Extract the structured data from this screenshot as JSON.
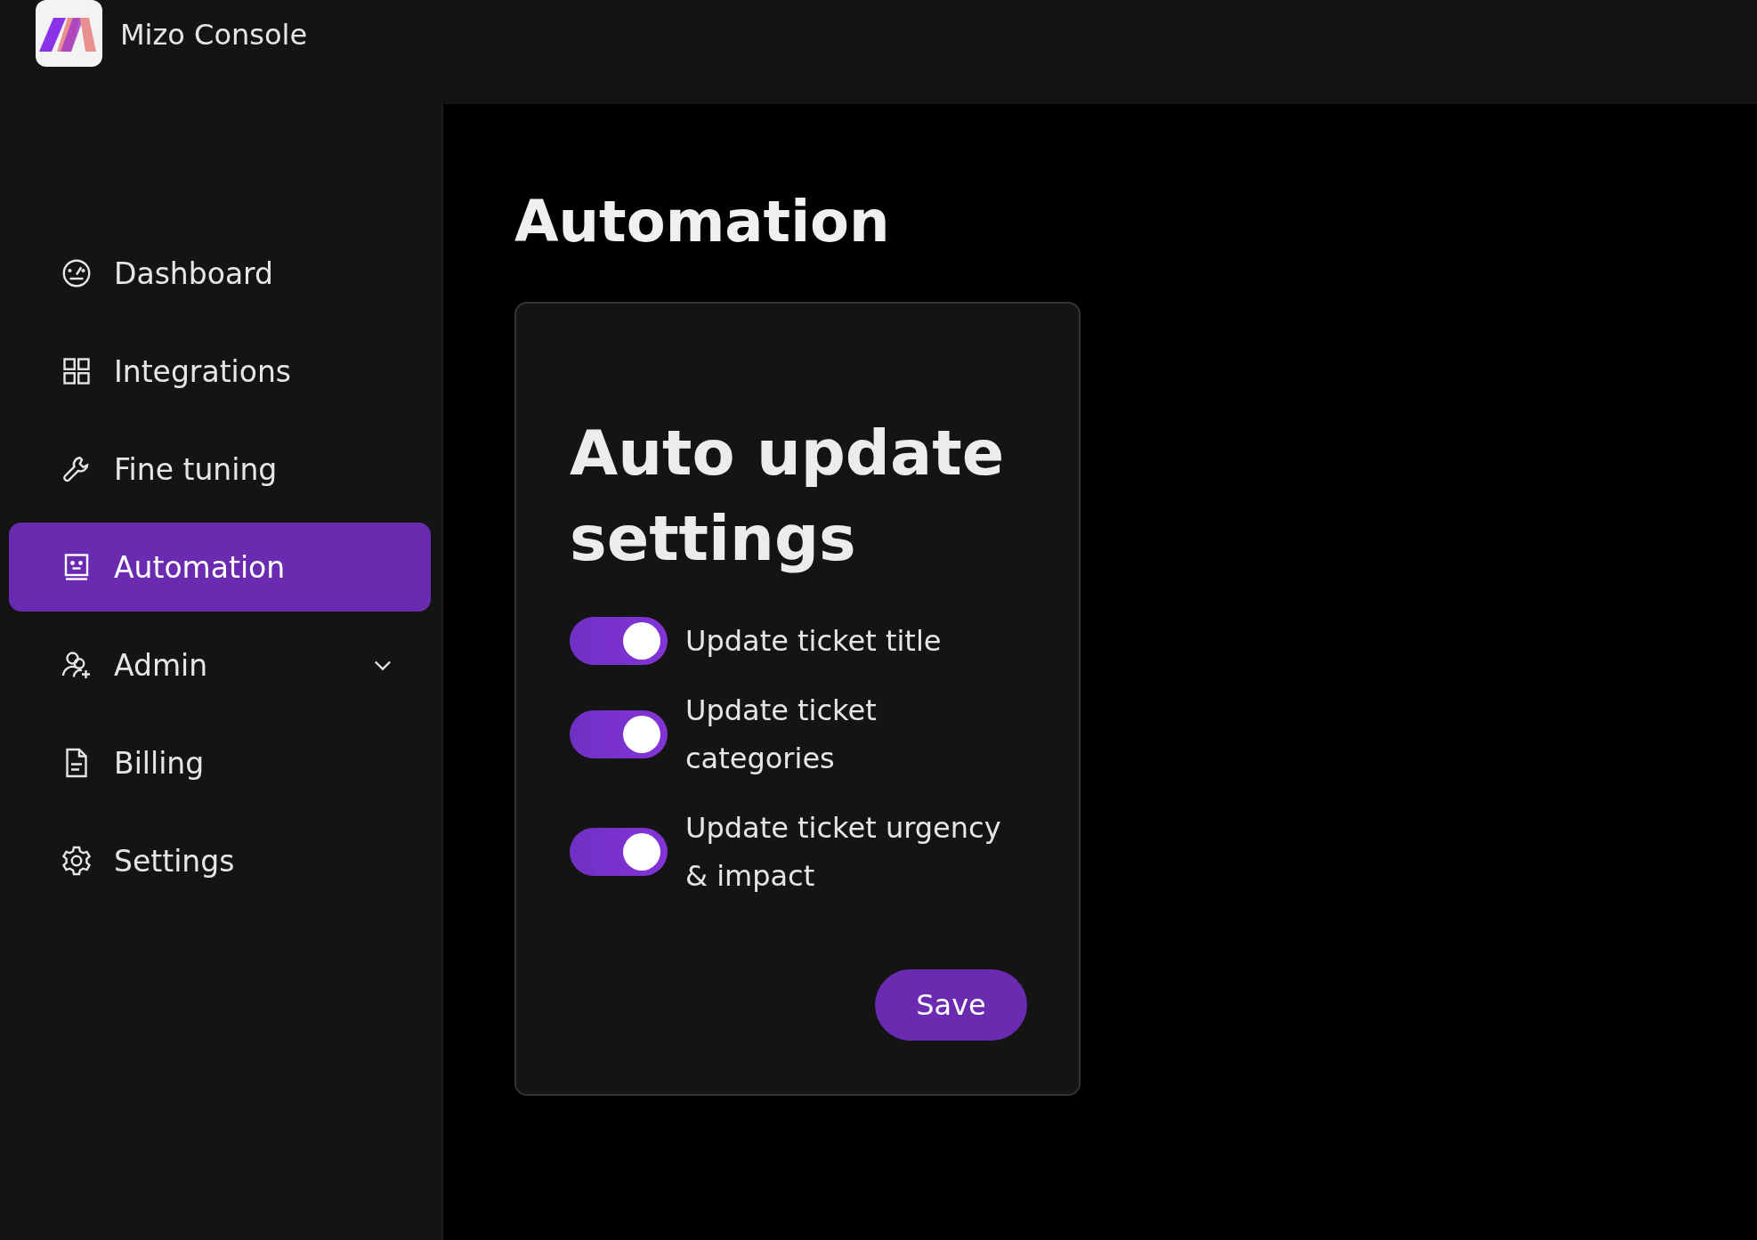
{
  "app": {
    "title": "Mizo Console"
  },
  "sidebar": {
    "items": [
      {
        "label": "Dashboard",
        "selected": false
      },
      {
        "label": "Integrations",
        "selected": false
      },
      {
        "label": "Fine tuning",
        "selected": false
      },
      {
        "label": "Automation",
        "selected": true
      },
      {
        "label": "Admin",
        "selected": false,
        "expanded": false
      },
      {
        "label": "Billing",
        "selected": false
      },
      {
        "label": "Settings",
        "selected": false
      }
    ]
  },
  "page": {
    "title": "Automation"
  },
  "card": {
    "title": "Auto update settings",
    "toggles": [
      {
        "label": "Update ticket title",
        "on": true
      },
      {
        "label": "Update ticket categories",
        "on": true
      },
      {
        "label": "Update ticket urgency & impact",
        "on": true
      }
    ],
    "save_button": "Save"
  }
}
